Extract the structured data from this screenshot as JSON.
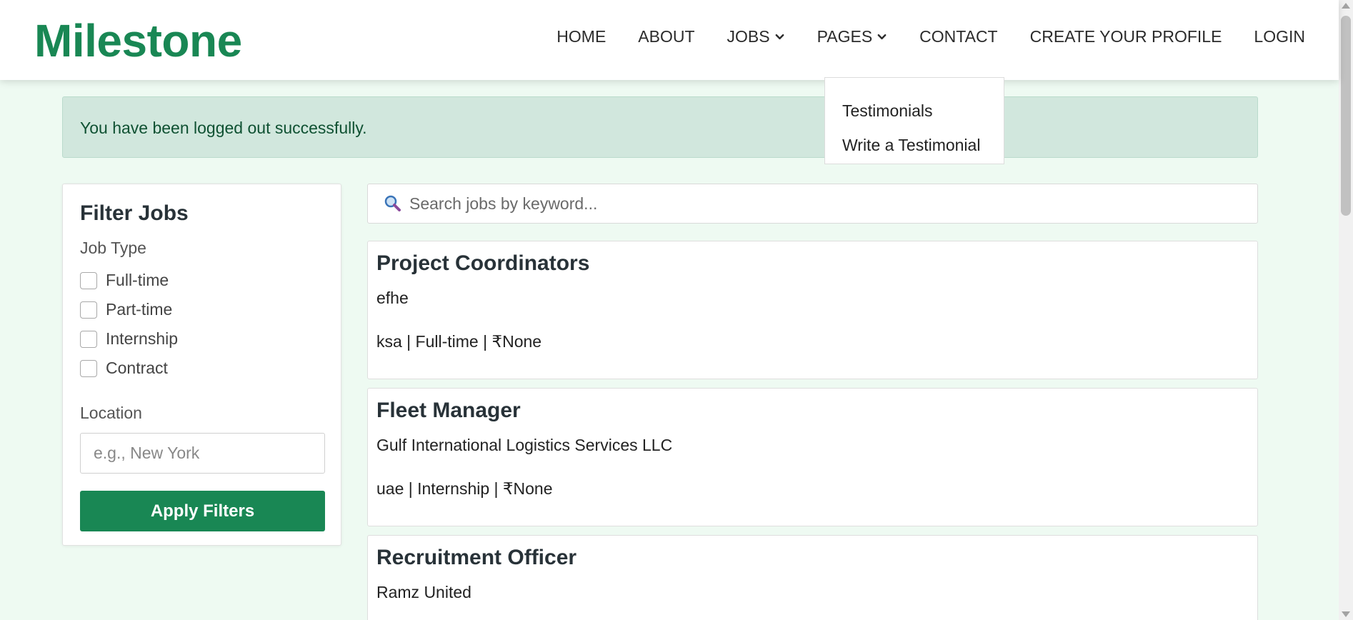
{
  "brand": {
    "name": "Milestone",
    "color": "#198754"
  },
  "nav": {
    "home": "HOME",
    "about": "ABOUT",
    "jobs": "JOBS",
    "pages": "PAGES",
    "contact": "CONTACT",
    "create_profile": "CREATE YOUR PROFILE",
    "login": "LOGIN"
  },
  "pages_dropdown": {
    "items": [
      "Testimonials",
      "Write a Testimonial"
    ]
  },
  "alert": {
    "message": "You have been logged out successfully."
  },
  "filter": {
    "title": "Filter Jobs",
    "job_type_label": "Job Type",
    "job_types": [
      "Full-time",
      "Part-time",
      "Internship",
      "Contract"
    ],
    "location_label": "Location",
    "location_placeholder": "e.g., New York",
    "apply_label": "Apply Filters"
  },
  "search": {
    "placeholder": "Search jobs by keyword..."
  },
  "jobs": [
    {
      "title": "Project Coordinators",
      "company": "efhe",
      "meta": "ksa | Full-time | ₹None"
    },
    {
      "title": "Fleet Manager",
      "company": "Gulf International Logistics Services LLC",
      "meta": "uae | Internship | ₹None"
    },
    {
      "title": "Recruitment Officer",
      "company": "Ramz United",
      "meta": ""
    }
  ]
}
